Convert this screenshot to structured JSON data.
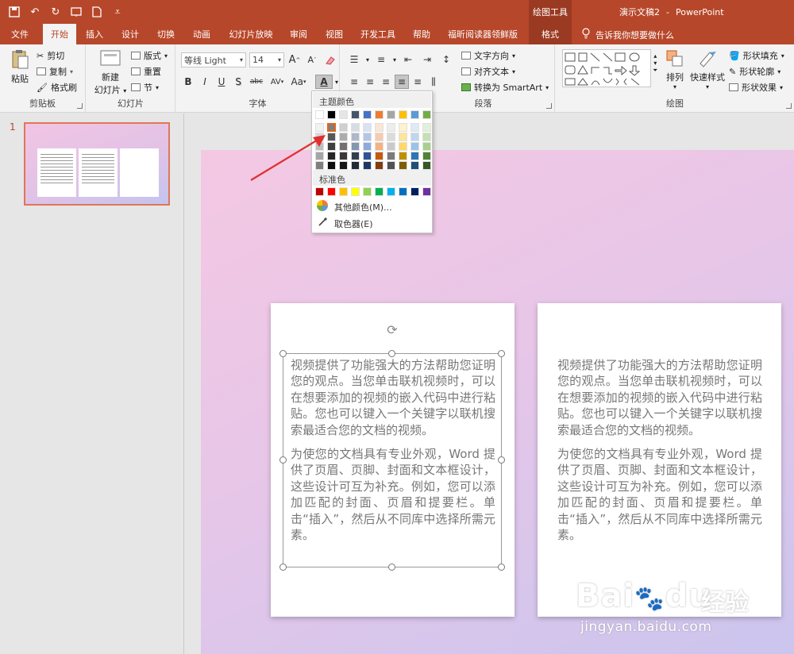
{
  "titlebar": {
    "context_tools": "绘图工具",
    "doc_name": "演示文稿2",
    "separator": "-",
    "app_name": "PowerPoint"
  },
  "tabs": [
    "文件",
    "开始",
    "插入",
    "设计",
    "切换",
    "动画",
    "幻灯片放映",
    "审阅",
    "视图",
    "开发工具",
    "帮助",
    "福昕阅读器领鲜版",
    "格式"
  ],
  "active_tab": "开始",
  "tell_me": "告诉我你想要做什么",
  "ribbon": {
    "clipboard": {
      "paste": "粘贴",
      "cut": "剪切",
      "copy": "复制",
      "format_painter": "格式刷",
      "label": "剪贴板"
    },
    "slides": {
      "new_slide_line1": "新建",
      "new_slide_line2": "幻灯片",
      "layout": "版式",
      "reset": "重置",
      "section": "节",
      "label": "幻灯片"
    },
    "font": {
      "font_name": "等线 Light",
      "font_size": "14",
      "label": "字体",
      "bold": "B",
      "italic": "I",
      "underline": "U",
      "shadow": "S",
      "strike": "abc",
      "spacing": "AV",
      "case": "Aa",
      "color": "A",
      "grow": "A",
      "shrink": "A"
    },
    "paragraph": {
      "text_direction": "文字方向",
      "align_text": "对齐文本",
      "smartart": "转换为 SmartArt",
      "label": "段落"
    },
    "drawing": {
      "arrange": "排列",
      "quick_styles": "快速样式",
      "shape_fill": "形状填充",
      "shape_outline": "形状轮廓",
      "shape_effects": "形状效果",
      "label": "绘图"
    }
  },
  "color_menu": {
    "theme_colors_label": "主题颜色",
    "standard_colors_label": "标准色",
    "more_colors": "其他颜色(M)...",
    "eyedropper": "取色器(E)",
    "theme_top": [
      "#ffffff",
      "#000000",
      "#e7e6e6",
      "#44546a",
      "#4472c4",
      "#ed7d31",
      "#a5a5a5",
      "#ffc000",
      "#5b9bd5",
      "#70ad47"
    ],
    "theme_shades": [
      [
        "#f2f2f2",
        "#7f7f7f",
        "#d0cece",
        "#d6dce4",
        "#d9e2f3",
        "#fbe5d5",
        "#ededed",
        "#fff2cc",
        "#deeaf6",
        "#e2efd9"
      ],
      [
        "#d8d8d8",
        "#595959",
        "#aeabab",
        "#adb9ca",
        "#b4c6e7",
        "#f7cbac",
        "#dbdbdb",
        "#fee599",
        "#bdd7ee",
        "#c5e0b3"
      ],
      [
        "#bfbfbf",
        "#3f3f3f",
        "#757070",
        "#8496b0",
        "#8eaadb",
        "#f4b183",
        "#c9c9c9",
        "#ffd965",
        "#9cc3e5",
        "#a8d08d"
      ],
      [
        "#a5a5a5",
        "#262626",
        "#3a3838",
        "#323f4f",
        "#2f5496",
        "#c55a11",
        "#7b7b7b",
        "#bf9000",
        "#2e75b5",
        "#538135"
      ],
      [
        "#7f7f7f",
        "#0c0c0c",
        "#171616",
        "#222a35",
        "#1f3864",
        "#833c0b",
        "#525252",
        "#7f6000",
        "#1e4e79",
        "#375623"
      ]
    ],
    "standard": [
      "#c00000",
      "#ff0000",
      "#ffc000",
      "#ffff00",
      "#92d050",
      "#00b050",
      "#00b0f0",
      "#0070c0",
      "#002060",
      "#7030a0"
    ]
  },
  "slide_panel": {
    "slide_number": "1"
  },
  "slide": {
    "card_left": {
      "p1": "视频提供了功能强大的方法帮助您证明您的观点。当您单击联机视频时，可以在想要添加的视频的嵌入代码中进行粘贴。您也可以键入一个关键字以联机搜索最适合您的文档的视频。",
      "p2": "为使您的文档具有专业外观，Word 提供了页眉、页脚、封面和文本框设计，这些设计可互为补充。例如，您可以添加匹配的封面、页眉和提要栏。单击“插入”，然后从不同库中选择所需元素。"
    },
    "card_right": {
      "p1": "视频提供了功能强大的方法帮助您证明您的观点。当您单击联机视频时，可以在想要添加的视频的嵌入代码中进行粘贴。您也可以键入一个关键字以联机搜索最适合您的文档的视频。",
      "p2": "为使您的文档具有专业外观，Word 提供了页眉、页脚、封面和文本框设计，这些设计可互为补充。例如，您可以添加匹配的封面、页眉和提要栏。单击“插入”，然后从不同库中选择所需元素。"
    }
  },
  "watermark": {
    "logo": "Bai",
    "logo_tail": "du",
    "cn": "经验",
    "url": "jingyan.baidu.com"
  },
  "colors": {
    "brand": "#b7472a",
    "accent_arrow": "#e03030"
  }
}
